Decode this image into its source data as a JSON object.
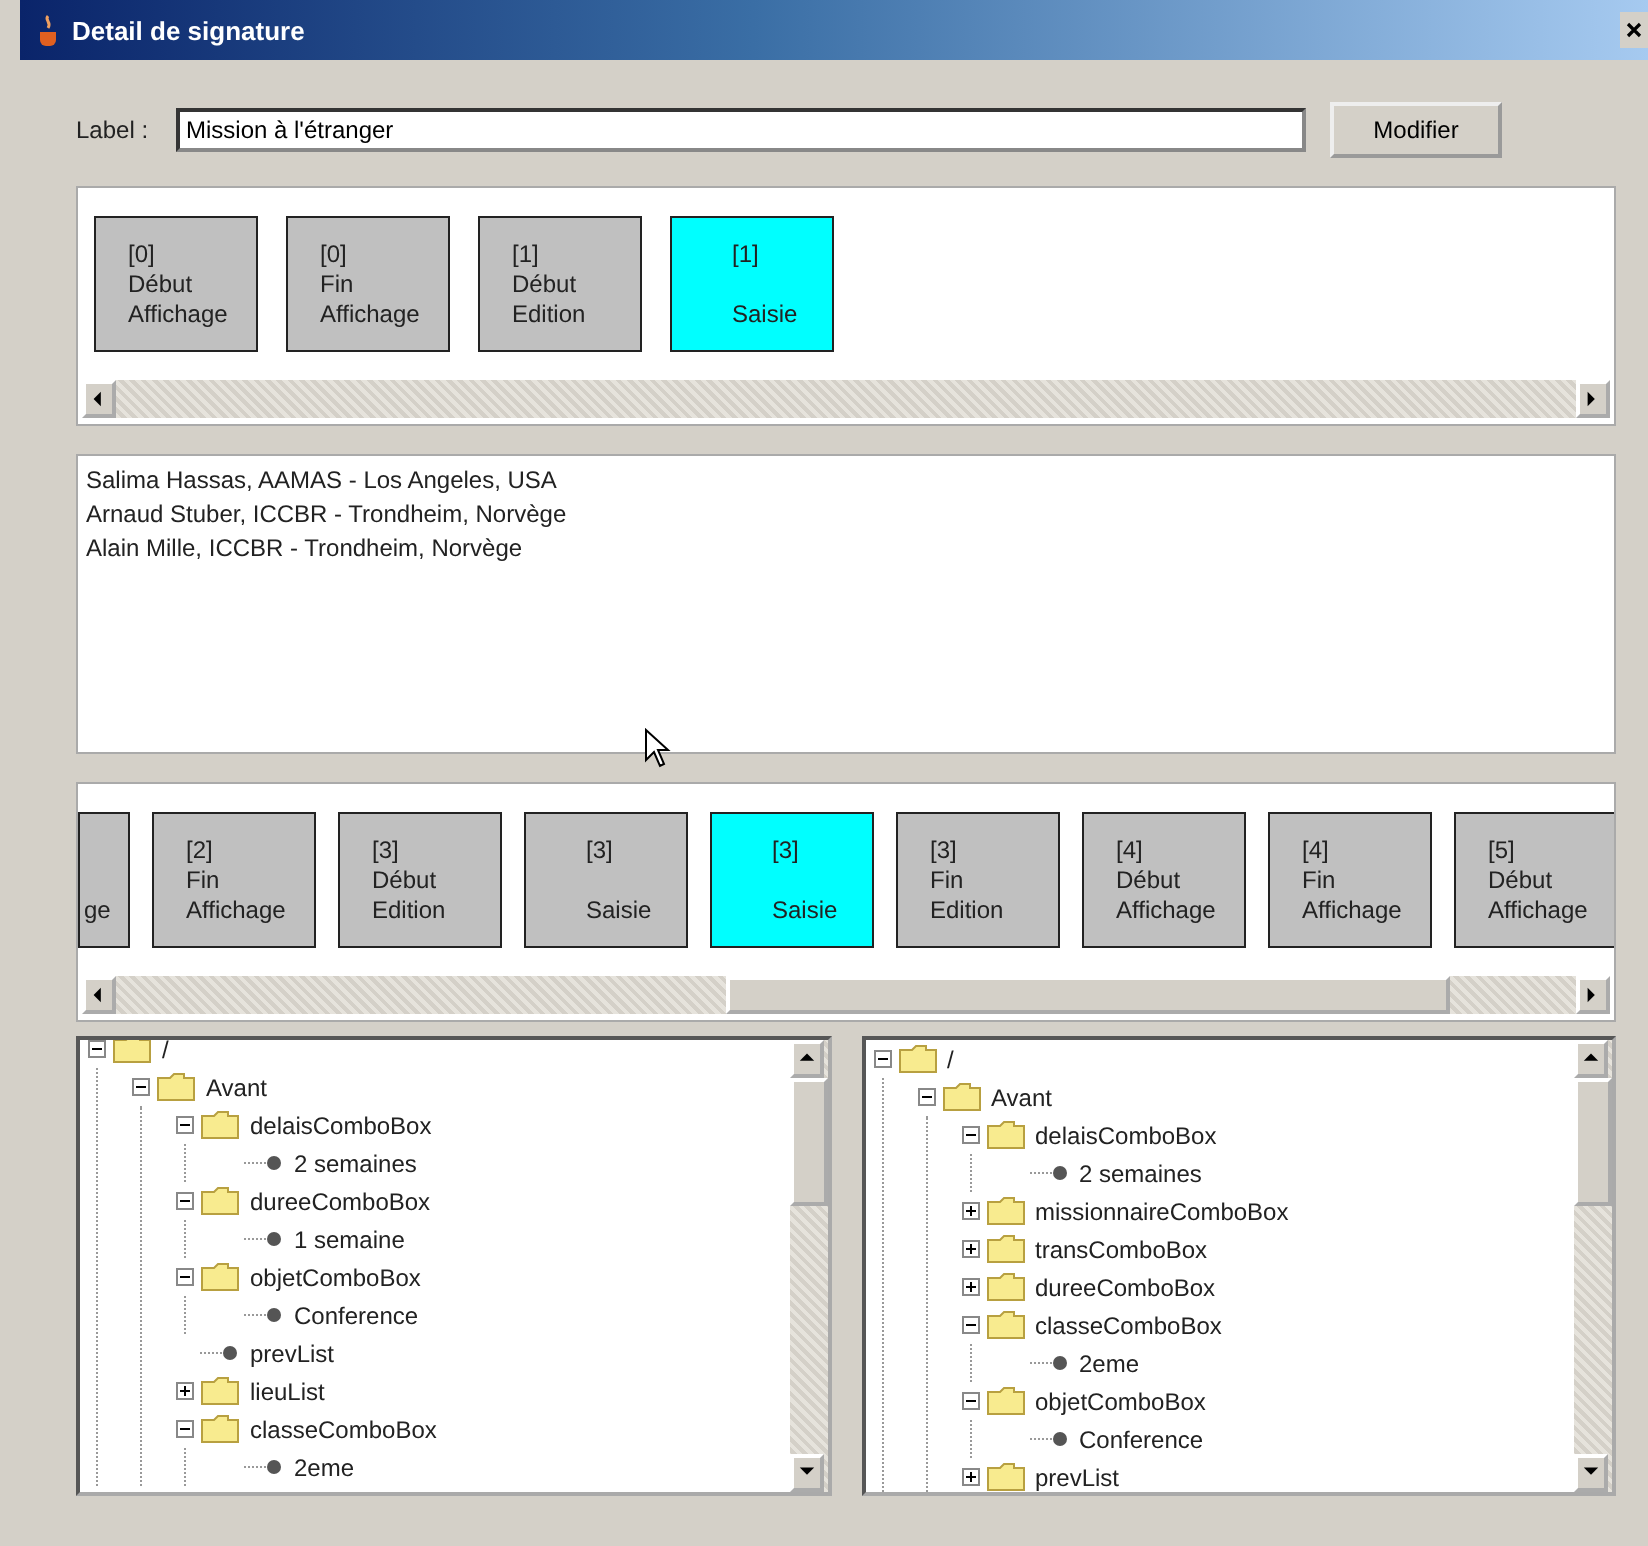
{
  "window": {
    "title": "Detail de signature"
  },
  "label_row": {
    "label": "Label :",
    "value": "Mission à l'étranger",
    "button": "Modifier"
  },
  "top_strip": {
    "cards": [
      {
        "index": "[0]",
        "word": "Début",
        "phase": "Affichage",
        "selected": false,
        "kind": "full"
      },
      {
        "index": "[0]",
        "word": "Fin",
        "phase": "Affichage",
        "selected": false,
        "kind": "full"
      },
      {
        "index": "[1]",
        "word": "Début",
        "phase": "Edition",
        "selected": false,
        "kind": "full"
      },
      {
        "index": "[1]",
        "phase": "Saisie",
        "selected": true,
        "kind": "full"
      }
    ]
  },
  "participants": [
    "Salima Hassas, AAMAS - Los Angeles, USA",
    "Arnaud Stuber, ICCBR - Trondheim, Norvège",
    "Alain Mille, ICCBR - Trondheim, Norvège"
  ],
  "bottom_strip": {
    "cards": [
      {
        "phase": "ge",
        "selected": false,
        "kind": "partial"
      },
      {
        "index": "[2]",
        "word": "Fin",
        "phase": "Affichage",
        "selected": false,
        "kind": "full"
      },
      {
        "index": "[3]",
        "word": "Début",
        "phase": "Edition",
        "selected": false,
        "kind": "full"
      },
      {
        "index": "[3]",
        "phase": "Saisie",
        "selected": false,
        "kind": "full"
      },
      {
        "index": "[3]",
        "phase": "Saisie",
        "selected": true,
        "kind": "full"
      },
      {
        "index": "[3]",
        "word": "Fin",
        "phase": "Edition",
        "selected": false,
        "kind": "full"
      },
      {
        "index": "[4]",
        "word": "Début",
        "phase": "Affichage",
        "selected": false,
        "kind": "full"
      },
      {
        "index": "[4]",
        "word": "Fin",
        "phase": "Affichage",
        "selected": false,
        "kind": "full"
      },
      {
        "index": "[5]",
        "word": "Début",
        "phase": "Affichage",
        "selected": false,
        "kind": "full"
      }
    ]
  },
  "trees": [
    {
      "nodes": [
        {
          "label": "/",
          "kind": "folder",
          "expanded": true,
          "children": [
            {
              "label": "Avant",
              "kind": "folder",
              "expanded": true,
              "children": [
                {
                  "label": "delaisComboBox",
                  "kind": "folder",
                  "expanded": true,
                  "children": [
                    {
                      "label": "2 semaines",
                      "kind": "leaf"
                    }
                  ]
                },
                {
                  "label": "dureeComboBox",
                  "kind": "folder",
                  "expanded": true,
                  "children": [
                    {
                      "label": "1 semaine",
                      "kind": "leaf"
                    }
                  ]
                },
                {
                  "label": "objetComboBox",
                  "kind": "folder",
                  "expanded": true,
                  "children": [
                    {
                      "label": "Conference",
                      "kind": "leaf"
                    }
                  ]
                },
                {
                  "label": "prevList",
                  "kind": "leaf"
                },
                {
                  "label": "lieuList",
                  "kind": "folder",
                  "expanded": false
                },
                {
                  "label": "classeComboBox",
                  "kind": "folder",
                  "expanded": true,
                  "children": [
                    {
                      "label": "2eme",
                      "kind": "leaf"
                    }
                  ]
                }
              ]
            }
          ]
        }
      ]
    },
    {
      "nodes": [
        {
          "label": "/",
          "kind": "folder",
          "expanded": true,
          "children": [
            {
              "label": "Avant",
              "kind": "folder",
              "expanded": true,
              "children": [
                {
                  "label": "delaisComboBox",
                  "kind": "folder",
                  "expanded": true,
                  "children": [
                    {
                      "label": "2 semaines",
                      "kind": "leaf"
                    }
                  ]
                },
                {
                  "label": "missionnaireComboBox",
                  "kind": "folder",
                  "expanded": false
                },
                {
                  "label": "transComboBox",
                  "kind": "folder",
                  "expanded": false
                },
                {
                  "label": "dureeComboBox",
                  "kind": "folder",
                  "expanded": false
                },
                {
                  "label": "classeComboBox",
                  "kind": "folder",
                  "expanded": true,
                  "children": [
                    {
                      "label": "2eme",
                      "kind": "leaf"
                    }
                  ]
                },
                {
                  "label": "objetComboBox",
                  "kind": "folder",
                  "expanded": true,
                  "children": [
                    {
                      "label": "Conference",
                      "kind": "leaf"
                    }
                  ]
                },
                {
                  "label": "prevList",
                  "kind": "folder",
                  "expanded": false
                }
              ]
            }
          ]
        }
      ]
    }
  ]
}
